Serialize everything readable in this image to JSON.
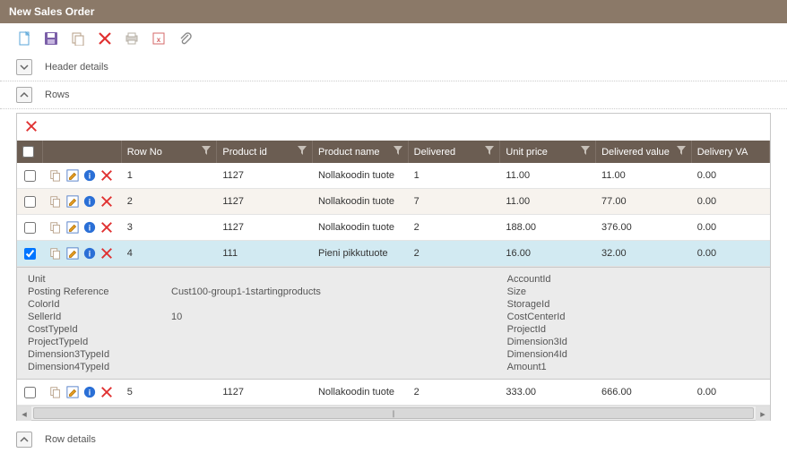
{
  "title": "New Sales Order",
  "sections": {
    "header_details": "Header details",
    "rows": "Rows",
    "row_details": "Row details"
  },
  "grid": {
    "columns": {
      "row_no": "Row No",
      "product_id": "Product id",
      "product_name": "Product name",
      "delivered": "Delivered",
      "unit_price": "Unit price",
      "delivered_value": "Delivered value",
      "delivery_va": "Delivery VA"
    },
    "rows": [
      {
        "checked": false,
        "row_no": "1",
        "product_id": "1127",
        "product_name": "Nollakoodin tuote",
        "delivered": "1",
        "unit_price": "11.00",
        "delivered_value": "11.00",
        "delivery_va": "0.00"
      },
      {
        "checked": false,
        "row_no": "2",
        "product_id": "1127",
        "product_name": "Nollakoodin tuote",
        "delivered": "7",
        "unit_price": "11.00",
        "delivered_value": "77.00",
        "delivery_va": "0.00"
      },
      {
        "checked": false,
        "row_no": "3",
        "product_id": "1127",
        "product_name": "Nollakoodin tuote",
        "delivered": "2",
        "unit_price": "188.00",
        "delivered_value": "376.00",
        "delivery_va": "0.00"
      },
      {
        "checked": true,
        "row_no": "4",
        "product_id": "111",
        "product_name": "Pieni pikkutuote",
        "delivered": "2",
        "unit_price": "16.00",
        "delivered_value": "32.00",
        "delivery_va": "0.00"
      },
      {
        "checked": false,
        "row_no": "5",
        "product_id": "1127",
        "product_name": "Nollakoodin tuote",
        "delivered": "2",
        "unit_price": "333.00",
        "delivered_value": "666.00",
        "delivery_va": "0.00"
      }
    ]
  },
  "details": {
    "left": [
      {
        "label": "Unit",
        "value": ""
      },
      {
        "label": "Posting Reference",
        "value": "Cust100-group1-1startingproducts"
      },
      {
        "label": "ColorId",
        "value": ""
      },
      {
        "label": "SellerId",
        "value": "10"
      },
      {
        "label": "CostTypeId",
        "value": ""
      },
      {
        "label": "ProjectTypeId",
        "value": ""
      },
      {
        "label": "Dimension3TypeId",
        "value": ""
      },
      {
        "label": "Dimension4TypeId",
        "value": ""
      }
    ],
    "right": [
      {
        "label": "AccountId",
        "value": ""
      },
      {
        "label": "Size",
        "value": ""
      },
      {
        "label": "StorageId",
        "value": ""
      },
      {
        "label": "CostCenterId",
        "value": ""
      },
      {
        "label": "ProjectId",
        "value": ""
      },
      {
        "label": "Dimension3Id",
        "value": ""
      },
      {
        "label": "Dimension4Id",
        "value": ""
      },
      {
        "label": "Amount1",
        "value": ""
      }
    ]
  }
}
